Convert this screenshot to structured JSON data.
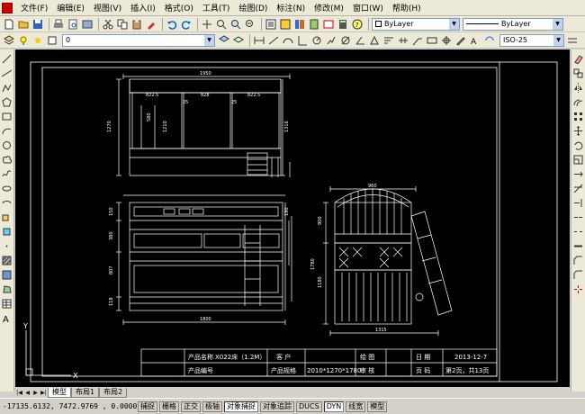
{
  "menu": {
    "items": [
      "文件(F)",
      "编辑(E)",
      "视图(V)",
      "插入(I)",
      "格式(O)",
      "工具(T)",
      "绘图(D)",
      "标注(N)",
      "修改(M)",
      "窗口(W)",
      "帮助(H)"
    ]
  },
  "toolbar": {
    "layer_color": "ByLayer",
    "linetype": "ByLayer",
    "layer_name": "0",
    "dimstyle": "ISO-25"
  },
  "drawing": {
    "dims": {
      "top_width": "1950",
      "seg1": "822.5",
      "seg2": "25",
      "seg3": "828",
      "seg4": "25",
      "seg5": "822.5",
      "left_height": "1270",
      "inner_h1": "580",
      "inner_h2": "1210",
      "right_h": "1316",
      "mid_h1": "150",
      "mid_h2": "380",
      "mid_h3": "807",
      "mid_h4": "118",
      "mid_h5": "190",
      "bottom_width": "1800",
      "side_top_width": "960",
      "side_h1": "900",
      "side_h2": "1780",
      "side_h3": "1180",
      "side_bottom_width": "1315"
    },
    "titleblock": {
      "product_name_label": "产品名称",
      "product_name": "X022床（1.2M）",
      "customer_label": "客  户",
      "draw_label": "绘  图",
      "date_label": "日  期",
      "date_value": "2013-12-7",
      "product_no_label": "产品编号",
      "spec_label": "产品规格",
      "spec_value": "2010*1270*1780",
      "review_label": "审  核",
      "page_label": "页  码",
      "page_value": "第2页，共13页"
    },
    "ucs": {
      "x": "X",
      "y": "Y"
    }
  },
  "tabs": {
    "items": [
      "模型",
      "布局1",
      "布局2"
    ]
  },
  "status": {
    "coords": "-17135.6132, 7472.9769 , 0.0000",
    "toggles": [
      "捕捉",
      "栅格",
      "正交",
      "极轴",
      "对象捕捉",
      "对象追踪",
      "DUCS",
      "DYN",
      "线宽",
      "模型"
    ]
  },
  "colors": {
    "canvas": "#000000",
    "line": "#ffffff",
    "border_yellow": "#ffffff",
    "accent_blue": "#0000ff"
  }
}
